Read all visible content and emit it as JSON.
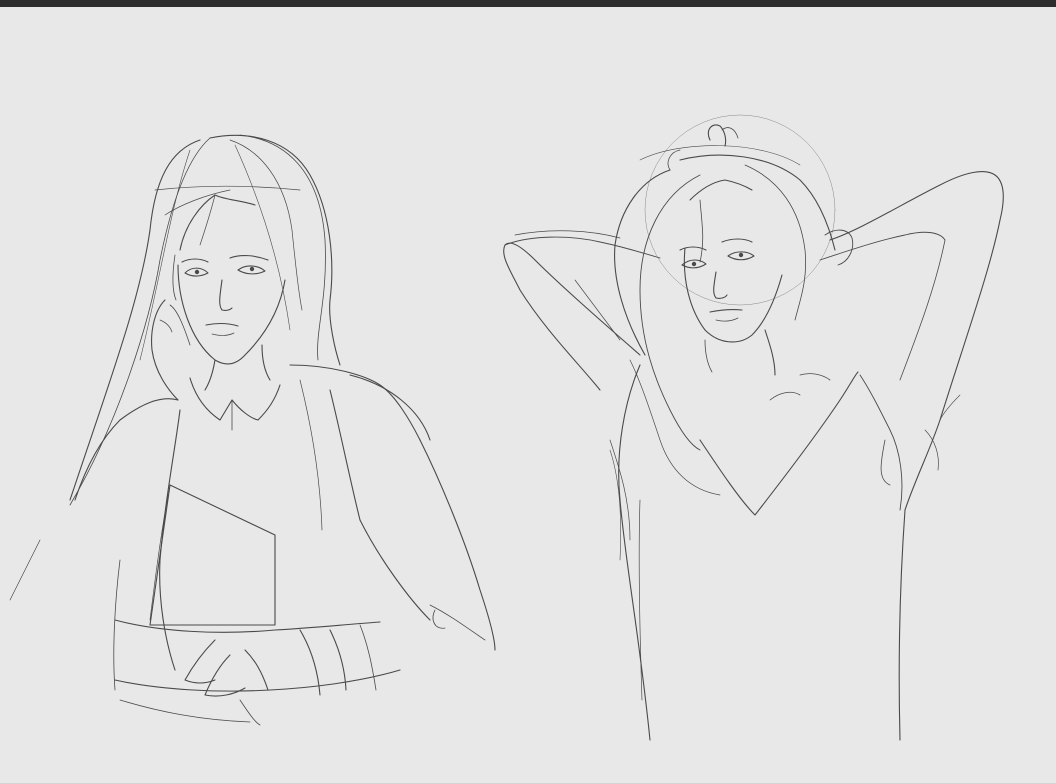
{
  "app": {
    "title": "",
    "canvas_color": "#e8e8e8",
    "toolbar_color": "#2d2d2d",
    "stroke_color": "#4a4a4a"
  },
  "artwork": {
    "subject": "pencil-sketches",
    "figures": [
      {
        "name": "woman-hand-on-cheek"
      },
      {
        "name": "woman-arms-behind-head"
      }
    ]
  }
}
